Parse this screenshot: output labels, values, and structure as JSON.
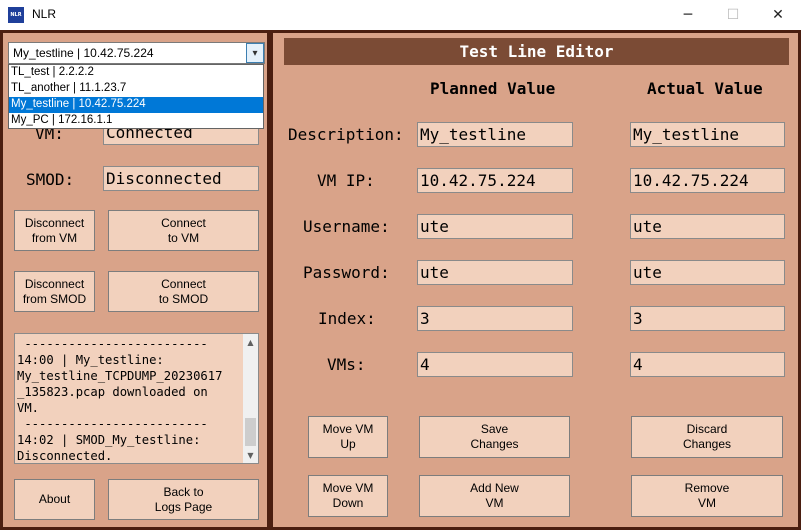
{
  "window": {
    "title": "NLR",
    "logo_text": "NLR",
    "min_glyph": "─",
    "max_glyph": "☐",
    "close_glyph": "✕"
  },
  "connection": {
    "selected": "My_testline | 10.42.75.224",
    "options": [
      "TL_test | 2.2.2.2",
      "TL_another | 11.1.23.7",
      "My_testline | 10.42.75.224",
      "My_PC | 172.16.1.1"
    ],
    "vm_label": "VM:",
    "vm_status": "Connected",
    "smod_label": "SMOD:",
    "smod_status": "Disconnected"
  },
  "left_buttons": {
    "disconnect_vm": "Disconnect\nfrom VM",
    "connect_vm": "Connect\nto VM",
    "disconnect_smod": "Disconnect\nfrom SMOD",
    "connect_smod": "Connect\nto SMOD",
    "about": "About",
    "back_logs": "Back to\nLogs Page"
  },
  "log": {
    "text": " -------------------------\n14:00 | My_testline:\nMy_testline_TCPDUMP_20230617\n_135823.pcap downloaded on\nVM.\n -------------------------\n14:02 | SMOD_My_testline:\nDisconnected.",
    "scroll_up": "▲",
    "scroll_down": "▼"
  },
  "editor": {
    "title": "Test Line Editor",
    "planned_header": "Planned Value",
    "actual_header": "Actual Value",
    "rows": [
      {
        "label": "Description:",
        "planned": "My_testline",
        "actual": "My_testline"
      },
      {
        "label": "VM IP:",
        "planned": "10.42.75.224",
        "actual": "10.42.75.224"
      },
      {
        "label": "Username:",
        "planned": "ute",
        "actual": "ute"
      },
      {
        "label": "Password:",
        "planned": "ute",
        "actual": "ute"
      },
      {
        "label": "Index:",
        "planned": "3",
        "actual": "3"
      },
      {
        "label": "VMs:",
        "planned": "4",
        "actual": "4"
      }
    ],
    "buttons": {
      "move_up": "Move VM\nUp",
      "save": "Save\nChanges",
      "discard": "Discard\nChanges",
      "move_down": "Move VM\nDown",
      "add": "Add New\nVM",
      "remove": "Remove\nVM"
    }
  },
  "colors": {
    "background": "#d9a389",
    "frame": "#4a1e10",
    "field": "#f2d1bd",
    "header": "#7b4b35",
    "selection": "#0078d7"
  }
}
